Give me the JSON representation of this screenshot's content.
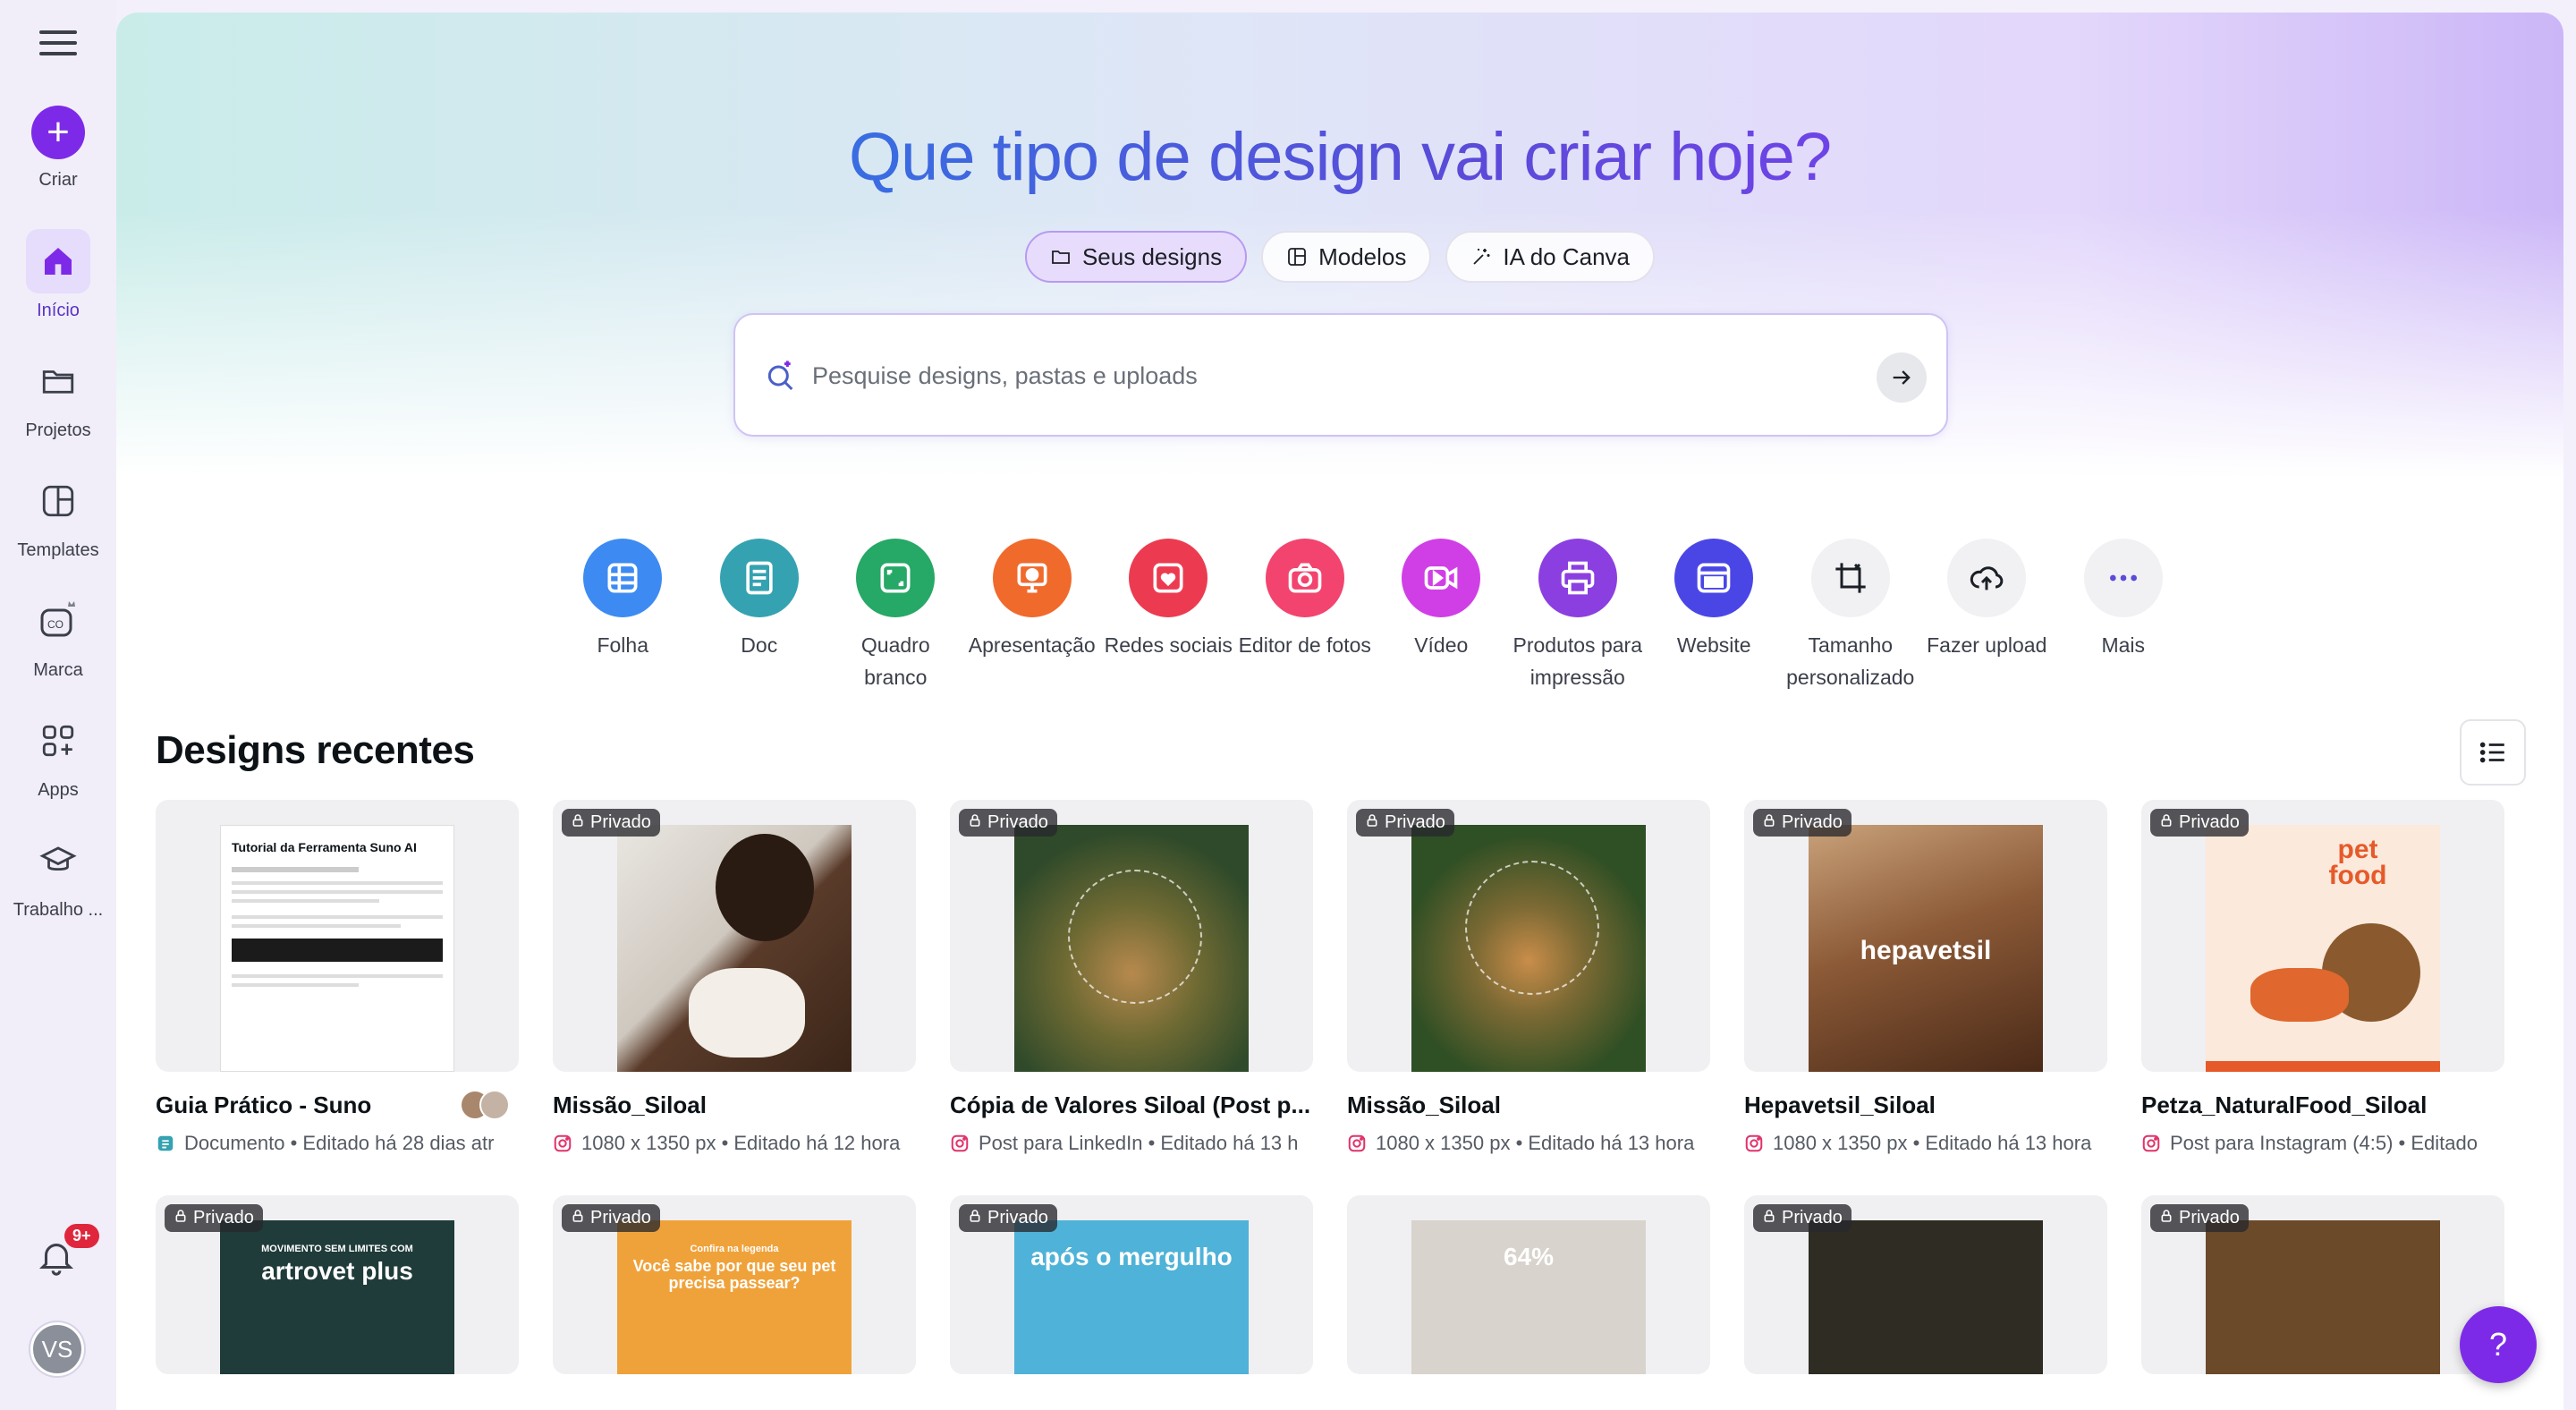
{
  "sidebar": {
    "criar": "Criar",
    "items": [
      {
        "label": "Início"
      },
      {
        "label": "Projetos"
      },
      {
        "label": "Templates"
      },
      {
        "label": "Marca"
      },
      {
        "label": "Apps"
      },
      {
        "label": "Trabalho ..."
      }
    ],
    "notifications_badge": "9+",
    "avatar_initials": "VS"
  },
  "hero": {
    "title": "Que tipo de design vai criar hoje?",
    "tabs": [
      {
        "label": "Seus designs",
        "selected": true
      },
      {
        "label": "Modelos",
        "selected": false
      },
      {
        "label": "IA do Canva",
        "selected": false
      }
    ],
    "search_placeholder": "Pesquise designs, pastas e uploads"
  },
  "quick_actions": [
    {
      "label": "Folha",
      "color": "#3d8bf2",
      "icon": "sheet-icon"
    },
    {
      "label": "Doc",
      "color": "#35a2b1",
      "icon": "doc-icon"
    },
    {
      "label": "Quadro branco",
      "color": "#26a866",
      "icon": "whiteboard-icon"
    },
    {
      "label": "Apresentação",
      "color": "#f06a2c",
      "icon": "presentation-icon"
    },
    {
      "label": "Redes sociais",
      "color": "#ec3b50",
      "icon": "heart-icon"
    },
    {
      "label": "Editor de fotos",
      "color": "#f2446e",
      "icon": "camera-icon"
    },
    {
      "label": "Vídeo",
      "color": "#d03fe6",
      "icon": "video-icon"
    },
    {
      "label": "Produtos para impressão",
      "color": "#8b3fe0",
      "icon": "print-icon"
    },
    {
      "label": "Website",
      "color": "#4a46e6",
      "icon": "website-icon"
    },
    {
      "label": "Tamanho personalizado",
      "color": "#f1f1f4",
      "icon": "crop-icon"
    },
    {
      "label": "Fazer upload",
      "color": "#f1f1f4",
      "icon": "upload-icon"
    },
    {
      "label": "Mais",
      "color": "#f1f1f4",
      "icon": "more-icon"
    }
  ],
  "recent": {
    "title": "Designs recentes",
    "private_label": "Privado",
    "cards": [
      {
        "title": "Guia Prático - Suno",
        "meta": "Documento • Editado há 28 dias atr",
        "private": false,
        "art": "doc",
        "doc_title": "Tutorial da Ferramenta Suno AI"
      },
      {
        "title": "Missão_Siloal",
        "meta": "1080 x 1350 px • Editado há 12 hora",
        "private": true,
        "art": "woman"
      },
      {
        "title": "Cópia de Valores Siloal (Post p...",
        "meta": "Post para LinkedIn • Editado há 13 h",
        "private": true,
        "art": "cat"
      },
      {
        "title": "Missão_Siloal",
        "meta": "1080 x 1350 px • Editado há 13 hora",
        "private": true,
        "art": "dog"
      },
      {
        "title": "Hepavetsil_Siloal",
        "meta": "1080 x 1350 px • Editado há 13 hora",
        "private": true,
        "art": "hepa",
        "art_text": "hepavetsil"
      },
      {
        "title": "Petza_NaturalFood_Siloal",
        "meta": "Post para Instagram (4:5) • Editado",
        "private": true,
        "art": "petfood",
        "art_text": "pet food"
      }
    ],
    "row2": [
      {
        "private": true,
        "art_text": "artrovet plus",
        "art_sub": "MOVIMENTO SEM LIMITES COM",
        "bg": "#1f3b3a"
      },
      {
        "private": true,
        "art_text": "Você sabe por que seu pet precisa passear?",
        "art_sub": "Confira na legenda",
        "bg": "#f0a23a"
      },
      {
        "private": true,
        "art_text": "após o mergulho",
        "art_sub": "",
        "bg": "#4fb2d8"
      },
      {
        "private": false,
        "art_text": "64%",
        "art_sub": "",
        "bg": "#d8d3cc"
      },
      {
        "private": true,
        "art_text": "",
        "art_sub": "",
        "bg": "#2f2c24"
      },
      {
        "private": true,
        "art_text": "",
        "art_sub": "",
        "bg": "#6b4a2a"
      }
    ]
  },
  "help_label": "?"
}
